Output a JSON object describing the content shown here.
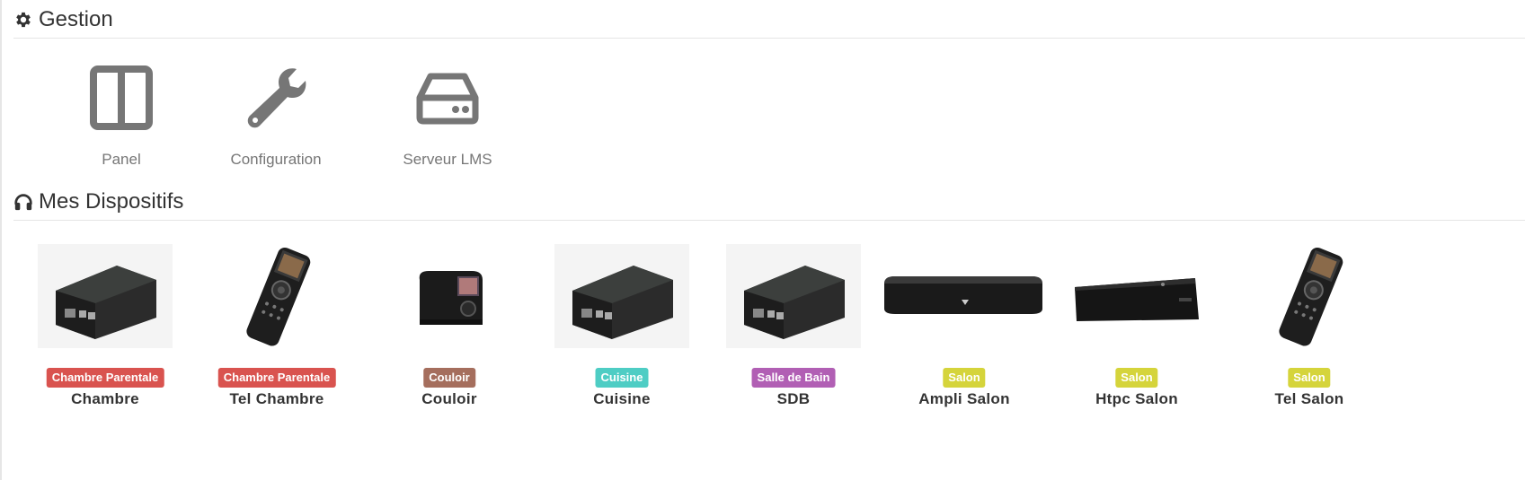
{
  "gestion": {
    "title": "Gestion",
    "title_icon": "gear-icon",
    "items": [
      {
        "label": "Panel",
        "icon": "panel-layout-icon"
      },
      {
        "label": "Configuration",
        "icon": "wrench-icon"
      },
      {
        "label": "Serveur LMS",
        "icon": "hard-drive-icon"
      }
    ]
  },
  "dispositifs": {
    "title": "Mes Dispositifs",
    "title_icon": "headphones-icon",
    "items": [
      {
        "name": "Chambre",
        "badge": "Chambre Parentale",
        "badge_color": "#d9534f",
        "image": "raspberry-pi-box"
      },
      {
        "name": "Tel Chambre",
        "badge": "Chambre Parentale",
        "badge_color": "#d9534f",
        "image": "remote-control"
      },
      {
        "name": "Couloir",
        "badge": "Couloir",
        "badge_color": "#a56e5d",
        "image": "internet-radio"
      },
      {
        "name": "Cuisine",
        "badge": "Cuisine",
        "badge_color": "#4ecdc4",
        "image": "raspberry-pi-box"
      },
      {
        "name": "SDB",
        "badge": "Salle de Bain",
        "badge_color": "#b15fb4",
        "image": "raspberry-pi-box"
      },
      {
        "name": "Ampli Salon",
        "badge": "Salon",
        "badge_color": "#d5d43b",
        "image": "media-player-slim"
      },
      {
        "name": "Htpc Salon",
        "badge": "Salon",
        "badge_color": "#d5d43b",
        "image": "htpc-case"
      },
      {
        "name": "Tel Salon",
        "badge": "Salon",
        "badge_color": "#d5d43b",
        "image": "remote-control"
      }
    ]
  }
}
